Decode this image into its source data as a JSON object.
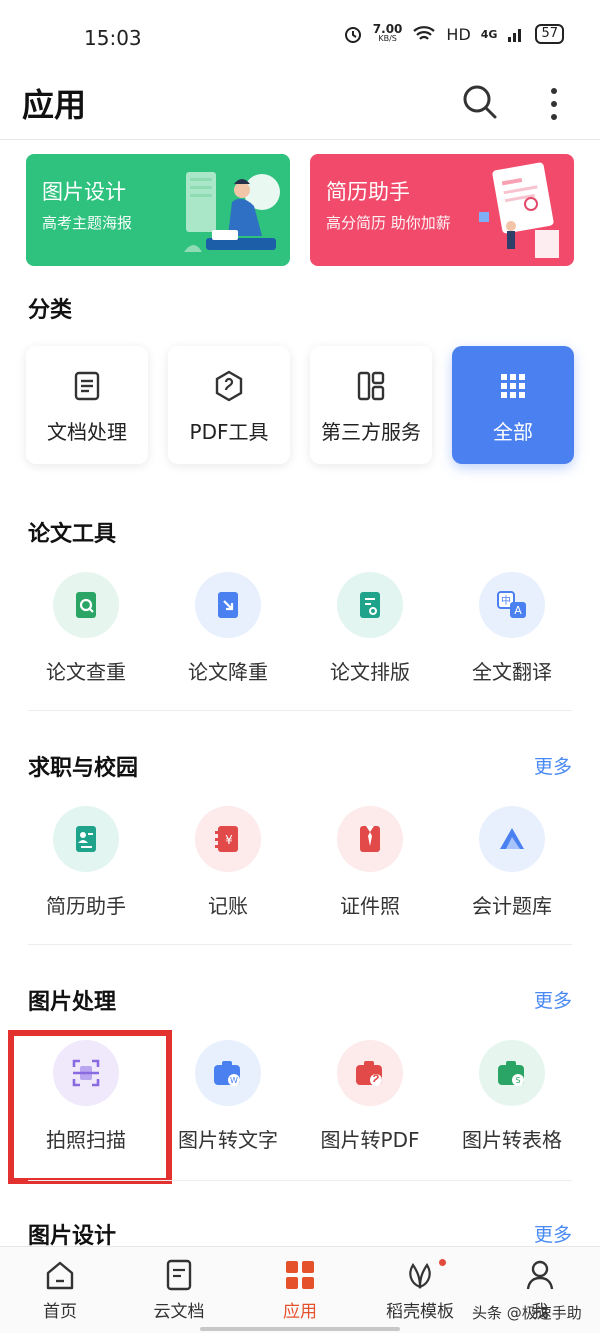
{
  "status": {
    "time": "15:03",
    "speed_value": "7.00",
    "speed_unit": "KB/S",
    "hd": "HD",
    "signal": "4G",
    "battery": "57"
  },
  "header": {
    "title": "应用"
  },
  "banners": [
    {
      "title": "图片设计",
      "subtitle": "高考主题海报",
      "color": "#2ec27e"
    },
    {
      "title": "简历助手",
      "subtitle": "高分简历 助你加薪",
      "color": "#f14a6b"
    }
  ],
  "categories": {
    "title": "分类",
    "items": [
      {
        "label": "文档处理",
        "icon": "document-icon"
      },
      {
        "label": "PDF工具",
        "icon": "pdf-icon"
      },
      {
        "label": "第三方服务",
        "icon": "grid-layout-icon"
      },
      {
        "label": "全部",
        "icon": "all-apps-icon"
      }
    ]
  },
  "paper_tools": {
    "title": "论文工具",
    "items": [
      {
        "label": "论文查重",
        "icon": "paper-check-icon",
        "bg": "#e6f6ee",
        "fg": "#2aa565"
      },
      {
        "label": "论文降重",
        "icon": "paper-reduce-icon",
        "bg": "#e8f0fd",
        "fg": "#4a80f0"
      },
      {
        "label": "论文排版",
        "icon": "paper-layout-icon",
        "bg": "#e3f5f1",
        "fg": "#1fa38b"
      },
      {
        "label": "全文翻译",
        "icon": "translate-icon",
        "bg": "#e8f0fd",
        "fg": "#4a80f0"
      }
    ]
  },
  "career": {
    "title": "求职与校园",
    "more": "更多",
    "items": [
      {
        "label": "简历助手",
        "icon": "resume-icon",
        "bg": "#e3f5f1",
        "fg": "#1fa38b"
      },
      {
        "label": "记账",
        "icon": "accounting-icon",
        "bg": "#fdeaea",
        "fg": "#e24a4a"
      },
      {
        "label": "证件照",
        "icon": "id-photo-icon",
        "bg": "#fdeaea",
        "fg": "#e24a4a"
      },
      {
        "label": "会计题库",
        "icon": "question-bank-icon",
        "bg": "#e8f0fd",
        "fg": "#4a80f0"
      }
    ]
  },
  "image_processing": {
    "title": "图片处理",
    "more": "更多",
    "items": [
      {
        "label": "拍照扫描",
        "icon": "scan-icon",
        "bg": "#efe9fb",
        "fg": "#8a6ae0"
      },
      {
        "label": "图片转文字",
        "icon": "image-to-text-icon",
        "bg": "#e8f0fd",
        "fg": "#4a80f0"
      },
      {
        "label": "图片转PDF",
        "icon": "image-to-pdf-icon",
        "bg": "#fdeaea",
        "fg": "#e24a4a"
      },
      {
        "label": "图片转表格",
        "icon": "image-to-sheet-icon",
        "bg": "#e6f6ee",
        "fg": "#2aa565"
      }
    ]
  },
  "image_design": {
    "title": "图片设计",
    "more": "更多"
  },
  "bottom_nav": [
    {
      "label": "首页",
      "icon": "home-icon"
    },
    {
      "label": "云文档",
      "icon": "cloud-doc-icon"
    },
    {
      "label": "应用",
      "icon": "apps-icon",
      "active": true
    },
    {
      "label": "稻壳模板",
      "icon": "template-icon"
    },
    {
      "label": "我",
      "icon": "user-icon"
    }
  ],
  "watermark": "头条 @极速手助",
  "accent": "#e4512b"
}
